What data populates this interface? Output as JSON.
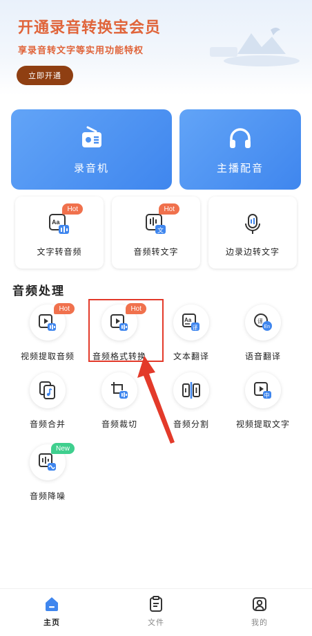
{
  "banner": {
    "title": "开通录音转换宝会员",
    "subtitle": "享录音转文字等实用功能特权",
    "button": "立即开通"
  },
  "big_cards": [
    {
      "label": "录音机",
      "icon": "radio-icon"
    },
    {
      "label": "主播配音",
      "icon": "headphones-icon"
    }
  ],
  "small_cards": [
    {
      "label": "文字转音频",
      "badge": "Hot",
      "icon": "text-to-audio-icon"
    },
    {
      "label": "音频转文字",
      "badge": "Hot",
      "icon": "audio-to-text-icon"
    },
    {
      "label": "边录边转文字",
      "icon": "microphone-icon"
    }
  ],
  "section": {
    "title": "音频处理"
  },
  "tools": [
    {
      "label": "视频提取音频",
      "badge": "Hot",
      "icon": "video-audio-icon"
    },
    {
      "label": "音频格式转换",
      "badge": "Hot",
      "icon": "format-convert-icon"
    },
    {
      "label": "文本翻译",
      "icon": "text-translate-icon"
    },
    {
      "label": "语音翻译",
      "icon": "voice-translate-icon"
    },
    {
      "label": "音频合并",
      "icon": "merge-icon"
    },
    {
      "label": "音频裁切",
      "icon": "crop-icon"
    },
    {
      "label": "音频分割",
      "icon": "split-icon"
    },
    {
      "label": "视频提取文字",
      "icon": "video-text-icon"
    },
    {
      "label": "音频降噪",
      "badge": "New",
      "icon": "denoise-icon"
    }
  ],
  "nav": [
    {
      "label": "主页",
      "icon": "home-icon",
      "active": true
    },
    {
      "label": "文件",
      "icon": "file-icon"
    },
    {
      "label": "我的",
      "icon": "user-icon"
    }
  ],
  "colors": {
    "accent": "#3f86ee",
    "banner_text": "#e0643a",
    "banner_button": "#8f3f12",
    "hot_badge": "#f0714d",
    "new_badge": "#3fcf8e",
    "highlight": "#e33a2a"
  }
}
